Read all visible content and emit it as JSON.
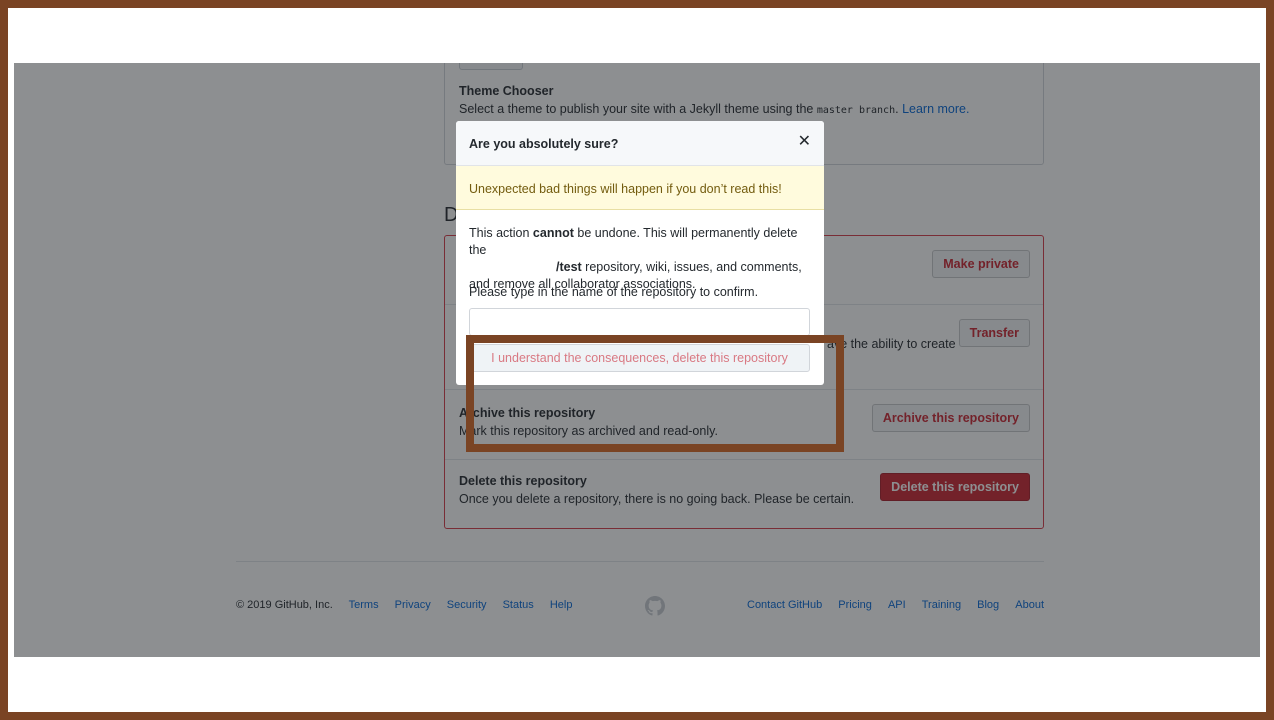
{
  "theme_chooser": {
    "title": "Theme Chooser",
    "description_before": "Select a theme to publish your site with a Jekyll theme using the ",
    "code": "master branch",
    "description_after": ". ",
    "learn_more": "Learn more."
  },
  "danger_zone": {
    "heading": "D",
    "rows": [
      {
        "title": "",
        "description": "",
        "button": "Make private"
      },
      {
        "title": "",
        "description": "ave the ability to create",
        "button": "Transfer"
      },
      {
        "title": "Archive this repository",
        "description": "Mark this repository as archived and read-only.",
        "button": "Archive this repository"
      },
      {
        "title": "Delete this repository",
        "description": "Once you delete a repository, there is no going back. Please be certain.",
        "button": "Delete this repository"
      }
    ]
  },
  "footer": {
    "copyright": "© 2019 GitHub, Inc.",
    "left_links": [
      "Terms",
      "Privacy",
      "Security",
      "Status",
      "Help"
    ],
    "right_links": [
      "Contact GitHub",
      "Pricing",
      "API",
      "Training",
      "Blog",
      "About"
    ],
    "logo_icon": "github-mark-icon"
  },
  "dialog": {
    "title": "Are you absolutely sure?",
    "close_icon": "close-icon",
    "flash": "Unexpected bad things will happen if you don’t read this!",
    "body_part1": "This action ",
    "body_bold1": "cannot",
    "body_part2": " be undone. This will permanently delete the",
    "body_bold2": "/test",
    "body_part3": " repository, wiki, issues, and comments, and remove all collaborator associations.",
    "confirm_label": "Please type in the name of the repository to confirm.",
    "confirm_input_value": "",
    "confirm_button": "I understand the consequences, delete this repository"
  },
  "colors": {
    "frame": "#7a4424",
    "danger": "#cb2431",
    "link": "#0366d6",
    "flash_bg": "#fffbdd"
  }
}
